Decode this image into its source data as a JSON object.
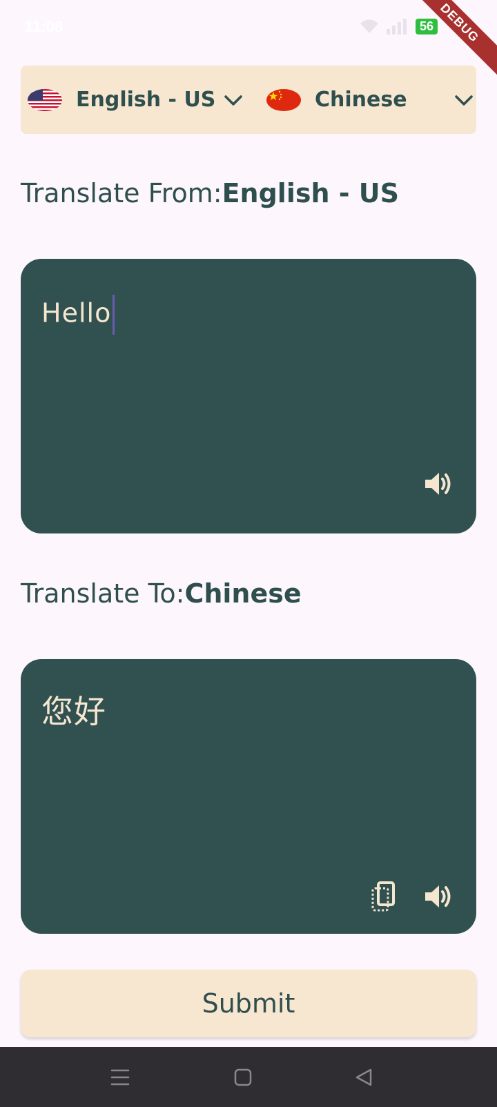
{
  "status_bar": {
    "time": "11:08",
    "battery": "56"
  },
  "debug_banner": "DEBUG",
  "language_bar": {
    "source": {
      "name": "English - US",
      "flag": "us-flag-icon"
    },
    "target": {
      "name": "Chinese",
      "flag": "china-flag-icon"
    }
  },
  "translate_from": {
    "prefix": "Translate From:",
    "language": "English - US"
  },
  "input_box": {
    "value": "Hello"
  },
  "translate_to": {
    "prefix": "Translate To:",
    "language": "Chinese"
  },
  "output_box": {
    "value": "您好"
  },
  "submit_label": "Submit",
  "colors": {
    "background": "#fdf7fd",
    "panel": "#f8e7d0",
    "box": "#315150",
    "text_dark": "#2f4f4f",
    "text_light": "#f5e6d0"
  }
}
